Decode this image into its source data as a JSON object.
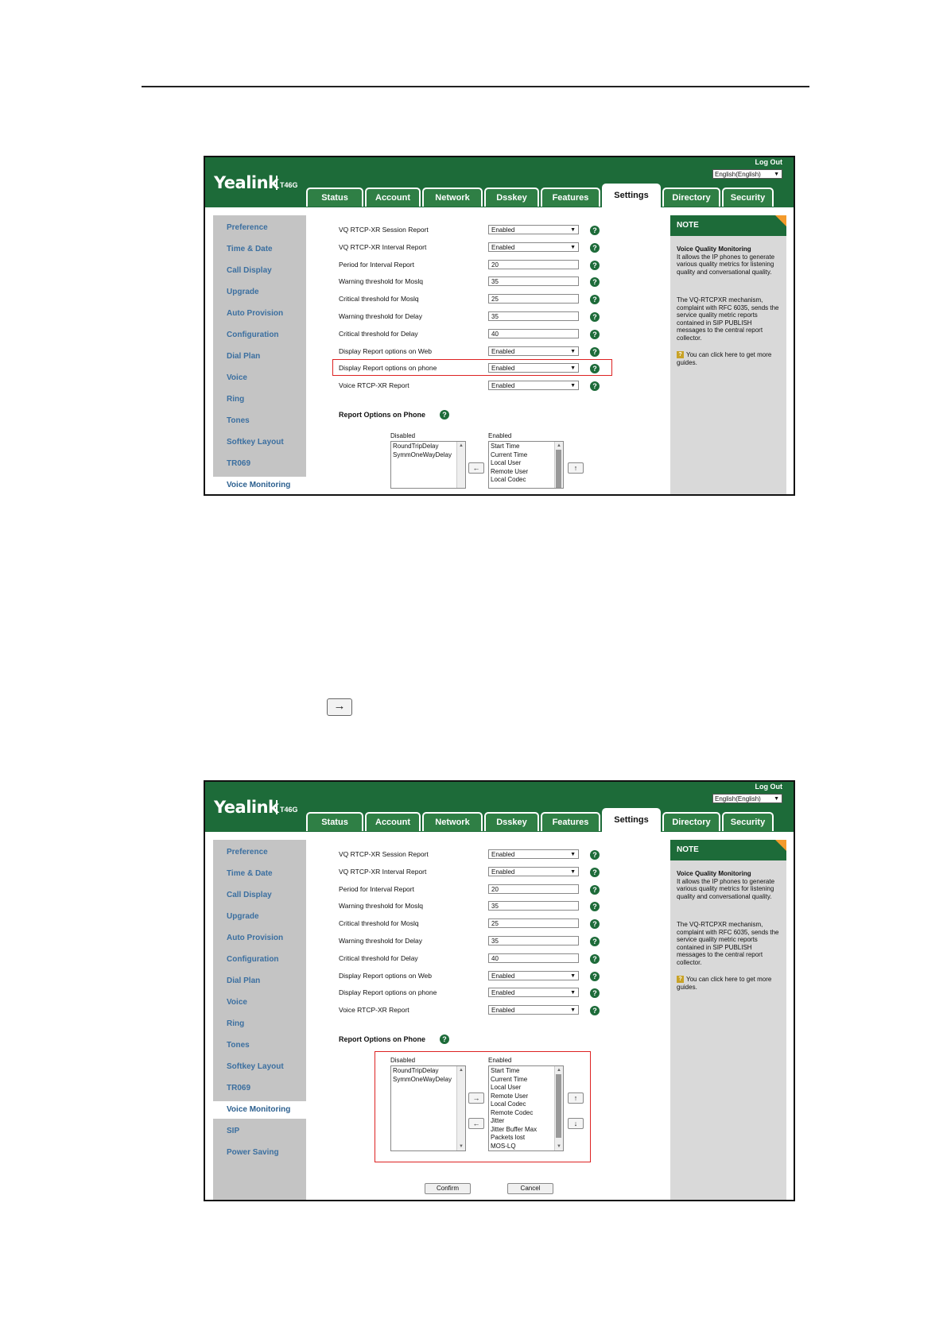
{
  "header": {
    "logo": "Yealink",
    "model": "T46G",
    "logout": "Log Out",
    "language": "English(English)"
  },
  "tabs": [
    {
      "label": "Status"
    },
    {
      "label": "Account"
    },
    {
      "label": "Network"
    },
    {
      "label": "Dsskey"
    },
    {
      "label": "Features"
    },
    {
      "label": "Settings",
      "active": true
    },
    {
      "label": "Directory"
    },
    {
      "label": "Security"
    }
  ],
  "sidebar": {
    "items": [
      "Preference",
      "Time & Date",
      "Call Display",
      "Upgrade",
      "Auto Provision",
      "Configuration",
      "Dial Plan",
      "Voice",
      "Ring",
      "Tones",
      "Softkey Layout",
      "TR069",
      "Voice Monitoring",
      "SIP",
      "Power Saving"
    ],
    "active": "Voice Monitoring"
  },
  "settings": [
    {
      "label": "VQ RTCP-XR Session Report",
      "value": "Enabled",
      "type": "select"
    },
    {
      "label": "VQ RTCP-XR Interval Report",
      "value": "Enabled",
      "type": "select"
    },
    {
      "label": "Period for Interval Report",
      "value": "20",
      "type": "text"
    },
    {
      "label": "Warning threshold for Moslq",
      "value": "35",
      "type": "text"
    },
    {
      "label": "Critical threshold for Moslq",
      "value": "25",
      "type": "text"
    },
    {
      "label": "Warning threshold for Delay",
      "value": "35",
      "type": "text"
    },
    {
      "label": "Critical threshold for Delay",
      "value": "40",
      "type": "text"
    },
    {
      "label": "Display Report options on Web",
      "value": "Enabled",
      "type": "select"
    },
    {
      "label": "Display Report options on phone",
      "value": "Enabled",
      "type": "select"
    },
    {
      "label": "Voice RTCP-XR Report",
      "value": "Enabled",
      "type": "select"
    }
  ],
  "report_options": {
    "title": "Report Options on Phone",
    "disabled_label": "Disabled",
    "enabled_label": "Enabled",
    "disabled_items": [
      "RoundTripDelay",
      "SymmOneWayDelay"
    ],
    "enabled_items": [
      "Start Time",
      "Current Time",
      "Local User",
      "Remote User",
      "Local Codec",
      "Remote Codec",
      "Jitter",
      "Jitter Buffer Max",
      "Packets lost",
      "MOS-LQ"
    ]
  },
  "note": {
    "header": "NOTE",
    "title": "Voice Quality Monitoring",
    "para1": "It allows the IP phones to generate various quality metrics for listening quality and conversational quality.",
    "para2": "The VQ-RTCPXR mechanism, complaint with RFC 6035, sends the service quality metric reports contained in SIP PUBLISH messages to the central report collector.",
    "guide_icon": "book-icon",
    "guide": "You can click here to get more guides."
  },
  "buttons": {
    "confirm": "Confirm",
    "cancel": "Cancel",
    "move_right": "→",
    "move_left": "←",
    "move_up": "↑",
    "move_down": "↓"
  },
  "colors": {
    "header_green": "#1d6b39",
    "highlight_red": "#dd2222",
    "note_corner": "#f39a2b"
  }
}
